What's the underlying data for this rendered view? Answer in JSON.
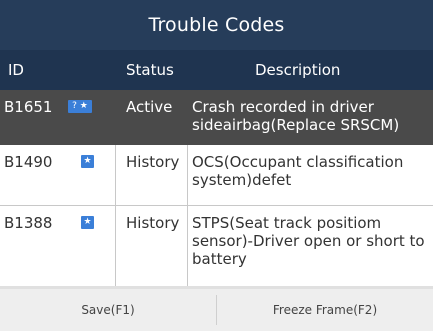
{
  "header": {
    "title": "Trouble Codes"
  },
  "columns": {
    "id": "ID",
    "status": "Status",
    "description": "Description"
  },
  "rows": [
    {
      "code": "B1651",
      "badge": "? ★",
      "status": "Active",
      "description": "Crash recorded in driver sideairbag(Replace SRSCM)",
      "selected": true
    },
    {
      "code": "B1490",
      "badge": "★",
      "status": "History",
      "description": "OCS(Occupant classification system)defet",
      "selected": false
    },
    {
      "code": "B1388",
      "badge": "★",
      "status": "History",
      "description": "STPS(Seat track positiom sensor)-Driver open or short to battery",
      "selected": false
    }
  ],
  "footer": {
    "save_label": "Save(F1)",
    "freeze_label": "Freeze Frame(F2)"
  },
  "colors": {
    "title_bg": "#263d5a",
    "header_bg": "#1f3450",
    "selected_row_bg": "#4a4a4a",
    "badge": "#3b7fd8"
  }
}
